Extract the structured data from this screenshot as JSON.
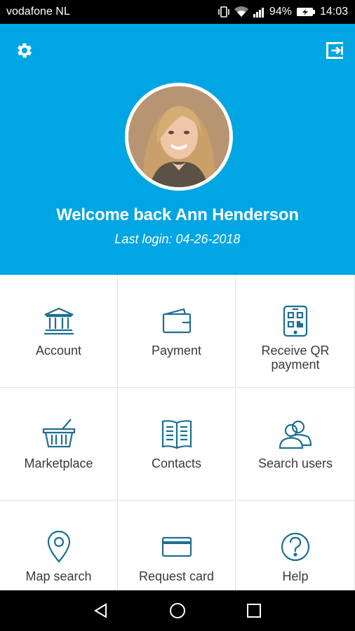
{
  "status_bar": {
    "carrier": "vodafone NL",
    "battery": "94%",
    "time": "14:03"
  },
  "header": {
    "welcome": "Welcome back Ann Henderson",
    "last_login": "Last login: 04-26-2018",
    "background_color": "#00a5e3"
  },
  "menu": [
    {
      "label": "Account",
      "icon": "bank-icon"
    },
    {
      "label": "Payment",
      "icon": "wallet-icon"
    },
    {
      "label": "Receive QR payment",
      "icon": "qr-phone-icon"
    },
    {
      "label": "Marketplace",
      "icon": "basket-icon"
    },
    {
      "label": "Contacts",
      "icon": "book-icon"
    },
    {
      "label": "Search users",
      "icon": "users-icon"
    },
    {
      "label": "Map search",
      "icon": "map-pin-icon"
    },
    {
      "label": "Request card",
      "icon": "card-icon"
    },
    {
      "label": "Help",
      "icon": "help-icon"
    }
  ],
  "icon_color": "#1c6f93"
}
